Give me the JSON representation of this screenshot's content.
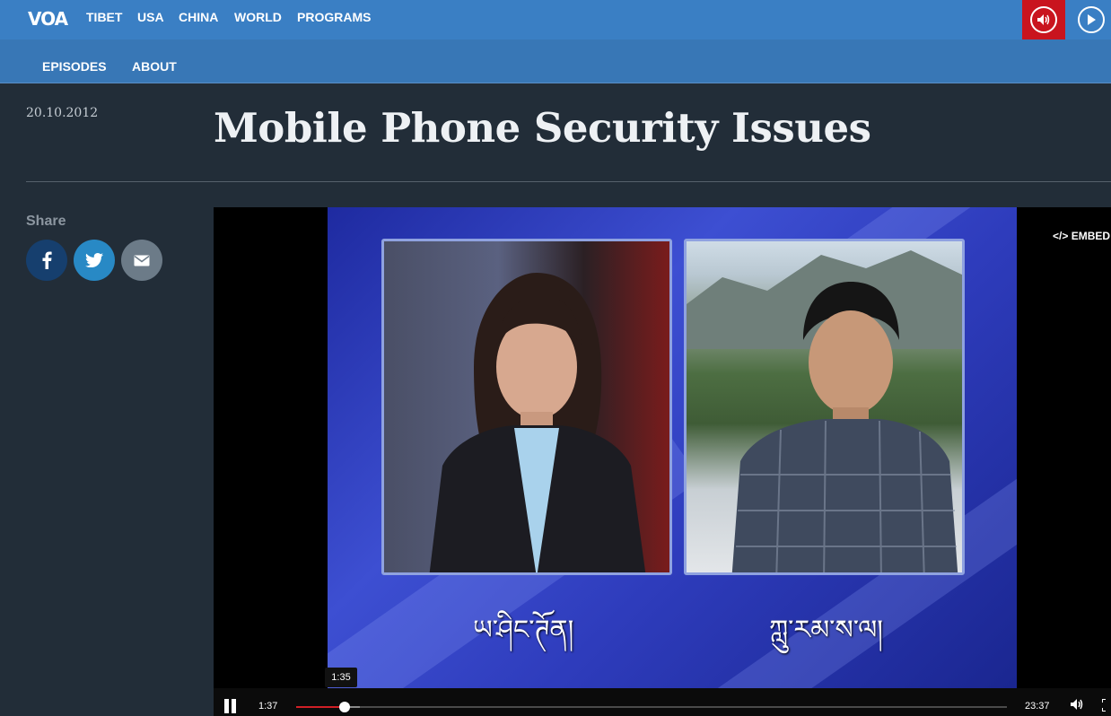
{
  "header": {
    "logo": "VOA",
    "nav": [
      "TIBET",
      "USA",
      "CHINA",
      "WORLD",
      "PROGRAMS"
    ],
    "audio_icon": "speaker-icon",
    "video_icon": "play-icon"
  },
  "subnav": [
    "EPISODES",
    "ABOUT"
  ],
  "article": {
    "date": "20.10.2012",
    "title": "Mobile Phone Security Issues"
  },
  "share": {
    "label": "Share",
    "buttons": [
      "facebook-icon",
      "twitter-icon",
      "email-icon"
    ]
  },
  "player": {
    "embed_label": "EMBED",
    "caption_left": "ཡ་ཤིང་ཊོན།",
    "caption_right": "ཀླུ་རམ་ས་ལ།",
    "hover_time": "1:35",
    "current_time": "1:37",
    "duration": "23:37",
    "progress_fraction": 0.0685,
    "buffered_fraction": 0.09
  },
  "colors": {
    "top_nav": "#3a7fc4",
    "sub_nav": "#3877b6",
    "page_bg": "#222d38",
    "audio_active": "#c9141e",
    "progress": "#d01f26"
  }
}
